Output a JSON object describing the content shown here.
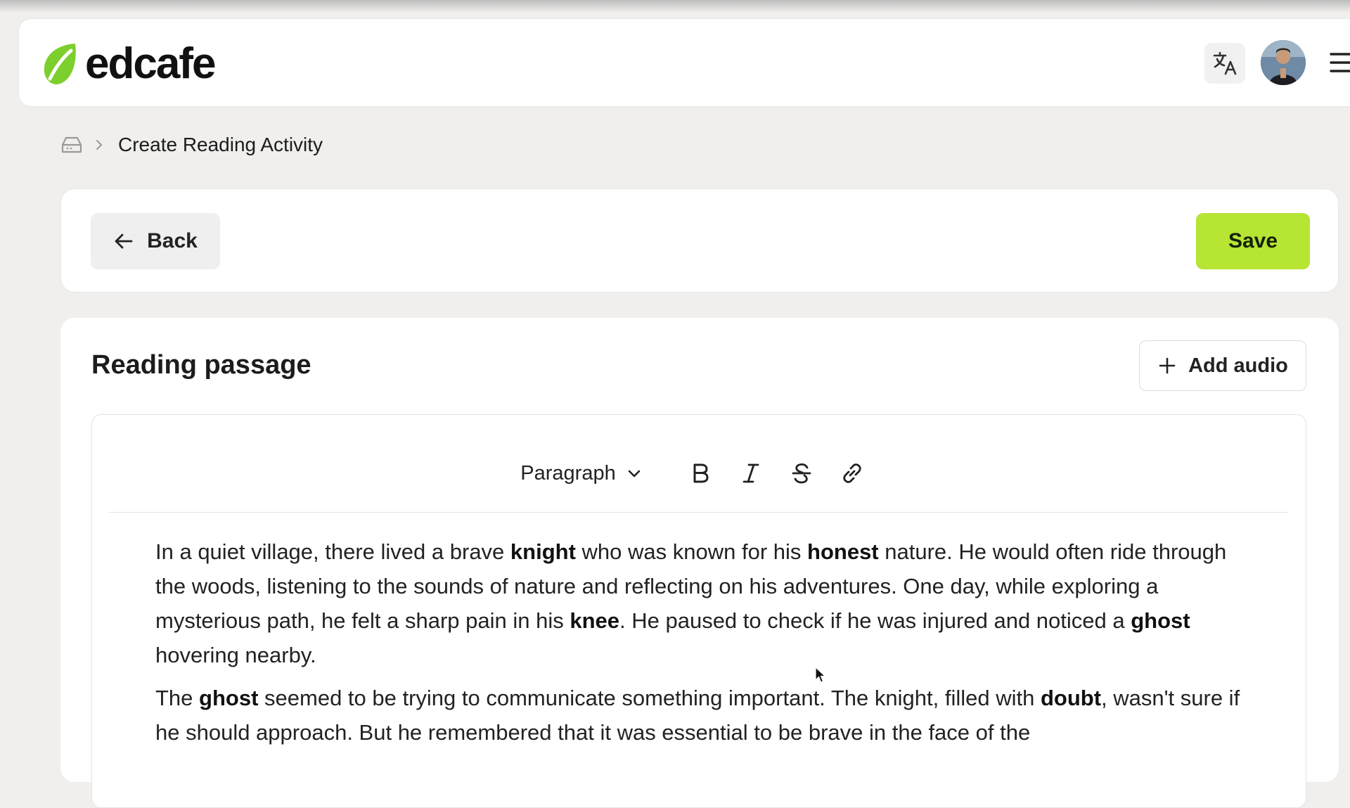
{
  "app": {
    "name": "edcafe"
  },
  "header": {
    "translate_icon": "translate-icon",
    "avatar_alt": "user-avatar",
    "menu_icon": "hamburger-menu-icon"
  },
  "breadcrumb": {
    "home_icon": "inbox-icon",
    "current": "Create Reading Activity"
  },
  "actions": {
    "back_label": "Back",
    "save_label": "Save"
  },
  "passage": {
    "title": "Reading passage",
    "add_audio_label": "Add audio",
    "toolbar": {
      "block_type": "Paragraph",
      "tools": [
        "bold-icon",
        "italic-icon",
        "strikethrough-icon",
        "link-icon"
      ]
    },
    "paragraphs": [
      [
        {
          "t": "In a quiet village, there lived a brave "
        },
        {
          "t": "knight",
          "b": true
        },
        {
          "t": " who was known for his "
        },
        {
          "t": "honest",
          "b": true
        },
        {
          "t": " nature. He would often ride through the woods, listening to the sounds of nature and reflecting on his adventures. One day, while exploring a mysterious path, he felt a sharp pain in his "
        },
        {
          "t": "knee",
          "b": true
        },
        {
          "t": ". He paused to check if he was injured and noticed a "
        },
        {
          "t": "ghost",
          "b": true
        },
        {
          "t": " hovering nearby."
        }
      ],
      [
        {
          "t": "The "
        },
        {
          "t": "ghost",
          "b": true
        },
        {
          "t": " seemed to be trying to communicate something important. The knight, filled with "
        },
        {
          "t": "doubt",
          "b": true
        },
        {
          "t": ", wasn't sure if he should approach. But he remembered that it was essential to be brave in the face of the"
        }
      ]
    ]
  },
  "colors": {
    "accent": "#b6e534",
    "logo_green": "#7ccf2c",
    "background": "#f0efed"
  }
}
